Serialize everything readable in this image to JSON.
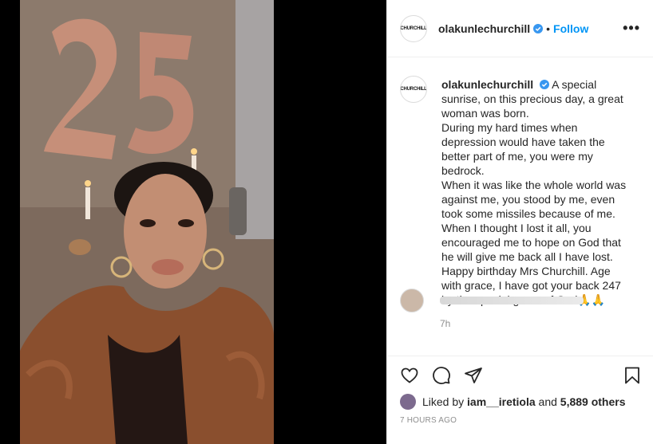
{
  "post": {
    "username": "olakunlechurchill",
    "follow_label": "Follow",
    "separator": "•",
    "more_label": "•••",
    "avatar_text": "CHURCHILL"
  },
  "caption": {
    "username": "olakunlechurchill",
    "lines": [
      "A special sunrise, on this precious day, a great woman was born.",
      "During my hard times when depression would have taken the better part of me, you were my bedrock.",
      "When it was like the whole world was against me, you stood by me, even took some missiles because of me.",
      "When I thought I lost it all, you encouraged me to hope on God that he will give me back all I have lost.",
      "Happy birthday Mrs Churchill. Age with grace, I have got your back 247 by the special grace of God🙏🙏"
    ],
    "relative_time": "7h"
  },
  "engagement": {
    "liked_by_prefix": "Liked by",
    "liked_by_user": "iam__iretiola",
    "and_label": "and",
    "others_label": "5,889 others",
    "posted_time": "7 HOURS AGO"
  },
  "icons": [
    "heart-icon",
    "comment-icon",
    "share-icon",
    "bookmark-icon",
    "verified-icon",
    "more-icon"
  ],
  "colors": {
    "accent": "#0095f6",
    "text": "#262626",
    "muted": "#8e8e8e",
    "border": "#efefef"
  }
}
